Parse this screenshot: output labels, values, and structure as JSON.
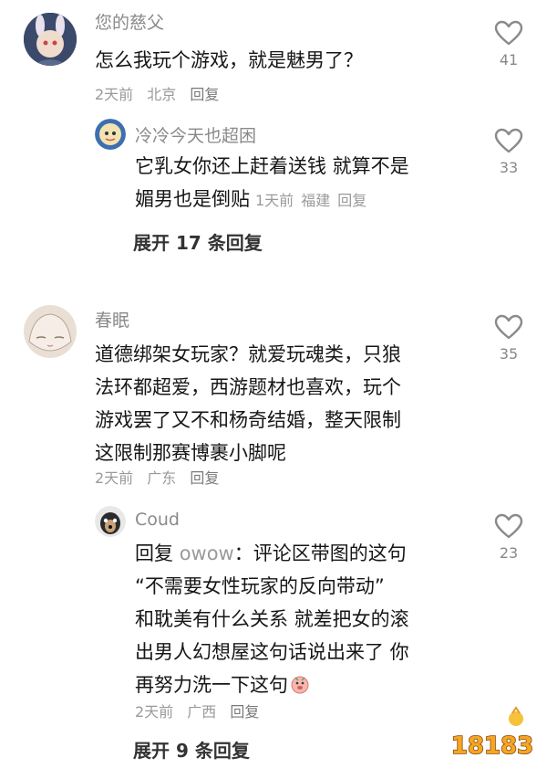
{
  "threads": [
    {
      "username": "您的慈父",
      "content": "怎么我玩个游戏，就是魅男了？",
      "date": "2天前",
      "location": "北京",
      "reply_label": "回复",
      "likes": "41",
      "reply": {
        "username": "冷冷今天也超困",
        "content_line1": "它乳女你还上赶着送钱 就算不是",
        "content_line2": "媚男也是倒贴",
        "date": "1天前",
        "location": "福建",
        "reply_label": "回复",
        "likes": "33"
      },
      "expand_label": "展开 17 条回复"
    },
    {
      "username": "春眠",
      "content_lines": [
        "道德绑架女玩家？就爱玩魂类，只狼",
        "法环都超爱，西游题材也喜欢，玩个",
        "游戏罢了又不和杨奇结婚，整天限制",
        "这限制那赛博裹小脚呢"
      ],
      "date": "2天前",
      "location": "广东",
      "reply_label": "回复",
      "likes": "35",
      "reply": {
        "username": "Coud",
        "reply_prefix": "回复",
        "reply_to": "owow",
        "content_lines": [
          "：评论区带图的这句",
          "“不需要女性玩家的反向带动”",
          "和耽美有什么关系 就差把女的滚",
          "出男人幻想屋这句话说出来了 你",
          "再努力洗一下这句"
        ],
        "date": "2天前",
        "location": "广西",
        "reply_label": "回复",
        "likes": "23"
      },
      "expand_label": "展开 9 条回复"
    }
  ],
  "watermark": {
    "text": "18183"
  },
  "colors": {
    "text": "#161616",
    "muted": "#9a9a9a",
    "username": "#8a8a8a",
    "watermark_orange": "#f5a623"
  }
}
